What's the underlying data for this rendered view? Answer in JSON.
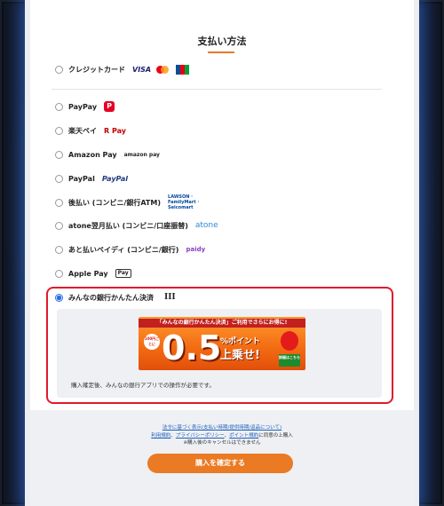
{
  "title": "支払い方法",
  "credit": {
    "label": "クレジットカード",
    "visa": "VISA"
  },
  "options": [
    {
      "label": "PayPay",
      "logo": "P"
    },
    {
      "label": "楽天ペイ",
      "logo": "R Pay"
    },
    {
      "label": "Amazon Pay",
      "logo": "amazon pay"
    },
    {
      "label": "PayPal",
      "logo": "PayPal"
    },
    {
      "label": "後払い (コンビニ/銀行ATM)",
      "logo": "LAWSON · FamilyMart · Seicomart"
    },
    {
      "label": "atone翌月払い (コンビニ/口座振替)",
      "logo": "atone"
    },
    {
      "label": "あと払いペイディ (コンビニ/銀行)",
      "logo": "paidy"
    },
    {
      "label": "Apple Pay",
      "logo": "Pay"
    }
  ],
  "selected": {
    "label": "みんなの銀行かんたん決済",
    "mark": "III",
    "banner": {
      "top_text": "「みんなの銀行かんたん決済」ご利用でさらにお得に!",
      "small": "100円ごとに",
      "big": "0.5",
      "point": "%ポイント",
      "up": "上乗せ!",
      "detail": "詳細はこちら"
    },
    "note": "購入確定後、みんなの銀行アプリでの操作が必要です。"
  },
  "legal": {
    "link1": "法令に基づく表示(支払い時期/提供時期/返品について)",
    "link2_a": "利用規約",
    "link2_b": "プライバシーポリシー",
    "link2_c": "ポイント規約",
    "link2_suffix": "に同意の上購入",
    "note": "※購入後のキャンセルはできません"
  },
  "confirm_label": "購入を確定する",
  "colors": {
    "accent": "#ea7a23",
    "highlight": "#e0192b",
    "radio_selected": "#2a6ee6"
  }
}
